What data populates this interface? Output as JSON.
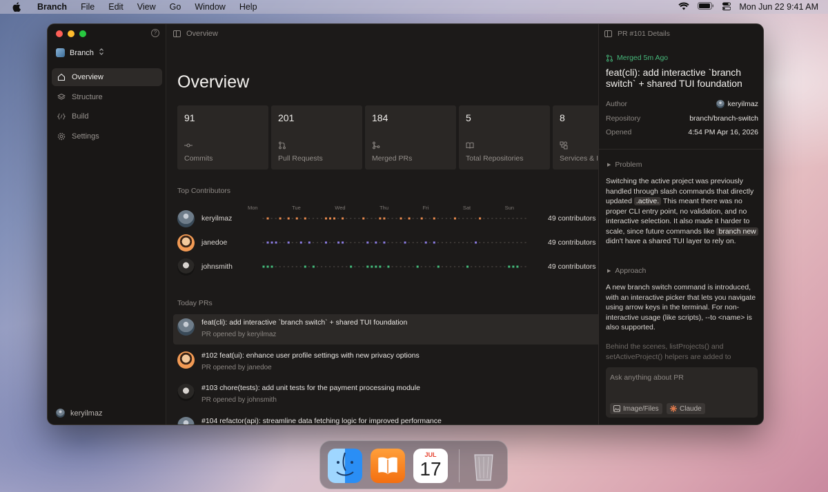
{
  "menubar": {
    "app": "Branch",
    "items": [
      "File",
      "Edit",
      "View",
      "Go",
      "Window",
      "Help"
    ],
    "datetime": "Mon Jun 22  9:41 AM"
  },
  "sidebar": {
    "workspace": "Branch",
    "nav": [
      {
        "label": "Overview",
        "icon": "home-icon",
        "active": true
      },
      {
        "label": "Structure",
        "icon": "layers-icon",
        "active": false
      },
      {
        "label": "Build",
        "icon": "code-icon",
        "active": false
      },
      {
        "label": "Settings",
        "icon": "gear-icon",
        "active": false
      }
    ],
    "user": "keryilmaz"
  },
  "main": {
    "breadcrumb": "Overview",
    "title": "Overview",
    "stats": [
      {
        "value": "91",
        "label": "Commits",
        "icon": "commit-icon"
      },
      {
        "value": "201",
        "label": "Pull Requests",
        "icon": "pull-request-icon"
      },
      {
        "value": "184",
        "label": "Merged PRs",
        "icon": "merge-icon"
      },
      {
        "value": "5",
        "label": "Total Repositories",
        "icon": "book-icon"
      },
      {
        "value": "8",
        "label": "Services & I",
        "icon": "services-icon"
      }
    ],
    "contributors_title": "Top Contributors",
    "days": [
      "Mon",
      "Tue",
      "Wed",
      "Thu",
      "Fri",
      "Sat",
      "Sun"
    ],
    "contributors": [
      {
        "name": "keryilmaz",
        "count": "49 contributors",
        "color": "#e98a4e",
        "activity": [
          0,
          1,
          0,
          0,
          1,
          0,
          1,
          0,
          1,
          0,
          1,
          0,
          0,
          0,
          0,
          1,
          1,
          1,
          0,
          1,
          0,
          0,
          0,
          0,
          1,
          0,
          0,
          0,
          1,
          1,
          0,
          0,
          0,
          1,
          0,
          1,
          0,
          0,
          1,
          0,
          0,
          1,
          0,
          0,
          0,
          0,
          1,
          0,
          0,
          0,
          0,
          0,
          1,
          0,
          0,
          0,
          0,
          0,
          0,
          0,
          0,
          0,
          0,
          0
        ]
      },
      {
        "name": "janedoe",
        "count": "49 contributors",
        "color": "#8a7be0",
        "activity": [
          0,
          1,
          1,
          1,
          0,
          0,
          1,
          0,
          0,
          1,
          0,
          1,
          0,
          0,
          0,
          1,
          0,
          0,
          1,
          1,
          0,
          0,
          0,
          0,
          0,
          1,
          0,
          1,
          0,
          1,
          0,
          0,
          0,
          0,
          1,
          0,
          0,
          0,
          0,
          1,
          0,
          1,
          0,
          0,
          0,
          0,
          0,
          0,
          0,
          0,
          0,
          1,
          0,
          0,
          0,
          0,
          0,
          0,
          0,
          0,
          0,
          0,
          0,
          0
        ]
      },
      {
        "name": "johnsmith",
        "count": "49 contributors",
        "color": "#45c07e",
        "activity": [
          1,
          1,
          1,
          0,
          0,
          0,
          0,
          0,
          0,
          0,
          1,
          0,
          1,
          0,
          0,
          0,
          0,
          0,
          0,
          0,
          0,
          1,
          0,
          0,
          0,
          1,
          1,
          1,
          1,
          0,
          1,
          0,
          0,
          0,
          0,
          0,
          0,
          1,
          0,
          0,
          0,
          0,
          1,
          0,
          0,
          0,
          0,
          0,
          0,
          1,
          0,
          0,
          0,
          0,
          0,
          0,
          0,
          0,
          0,
          1,
          1,
          1,
          0,
          0
        ]
      }
    ],
    "today_title": "Today PRs",
    "prs": [
      {
        "title": "feat(cli): add interactive `branch switch` + shared TUI foundation",
        "sub": "PR opened by keryilmaz",
        "avatar": "k"
      },
      {
        "title": "#102 feat(ui): enhance user profile settings with new privacy options",
        "sub": "PR opened by janedoe",
        "avatar": "j"
      },
      {
        "title": "#103 chore(tests): add unit tests for the payment processing module",
        "sub": "PR opened by johnsmith",
        "avatar": "s"
      },
      {
        "title": "#104 refactor(api): streamline data fetching logic for improved performance",
        "sub": "",
        "avatar": "k"
      }
    ]
  },
  "details": {
    "header": "PR #101 Details",
    "status": "Merged 5m Ago",
    "title": "feat(cli): add interactive `branch switch` + shared TUI foundation",
    "meta": [
      {
        "key": "Author",
        "value": "keryilmaz"
      },
      {
        "key": "Repository",
        "value": "branch/branch-switch"
      },
      {
        "key": "Opened",
        "value": "4:54 PM Apr 16, 2026"
      }
    ],
    "problem_label": "Problem",
    "problem": {
      "p1": "Switching the active project was previously handled through slash commands that directly updated ",
      "code1": ".active.",
      "p2": " This meant there was no proper CLI entry point, no validation, and no interactive selection. It also made it harder to scale, since future commands like ",
      "code2": "branch new",
      "p3": " didn't have a shared TUI layer to rely on."
    },
    "approach_label": "Approach",
    "approach1": "A new branch switch command is introduced, with an interactive picker that lets you navigate using arrow keys in the terminal. For non-interactive usage (like scripts), --to <name> is also supported.",
    "approach2": "Behind the scenes, listProjects() and setActiveProject() helpers are added to",
    "chat_placeholder": "Ask anything about PR",
    "chip_files": "Image/Files",
    "chip_model": "Claude"
  },
  "dock": {
    "calendar_month": "JUL",
    "calendar_day": "17"
  },
  "colors": {
    "accent_green": "#46b77a",
    "window_bg": "#1c1a19"
  }
}
